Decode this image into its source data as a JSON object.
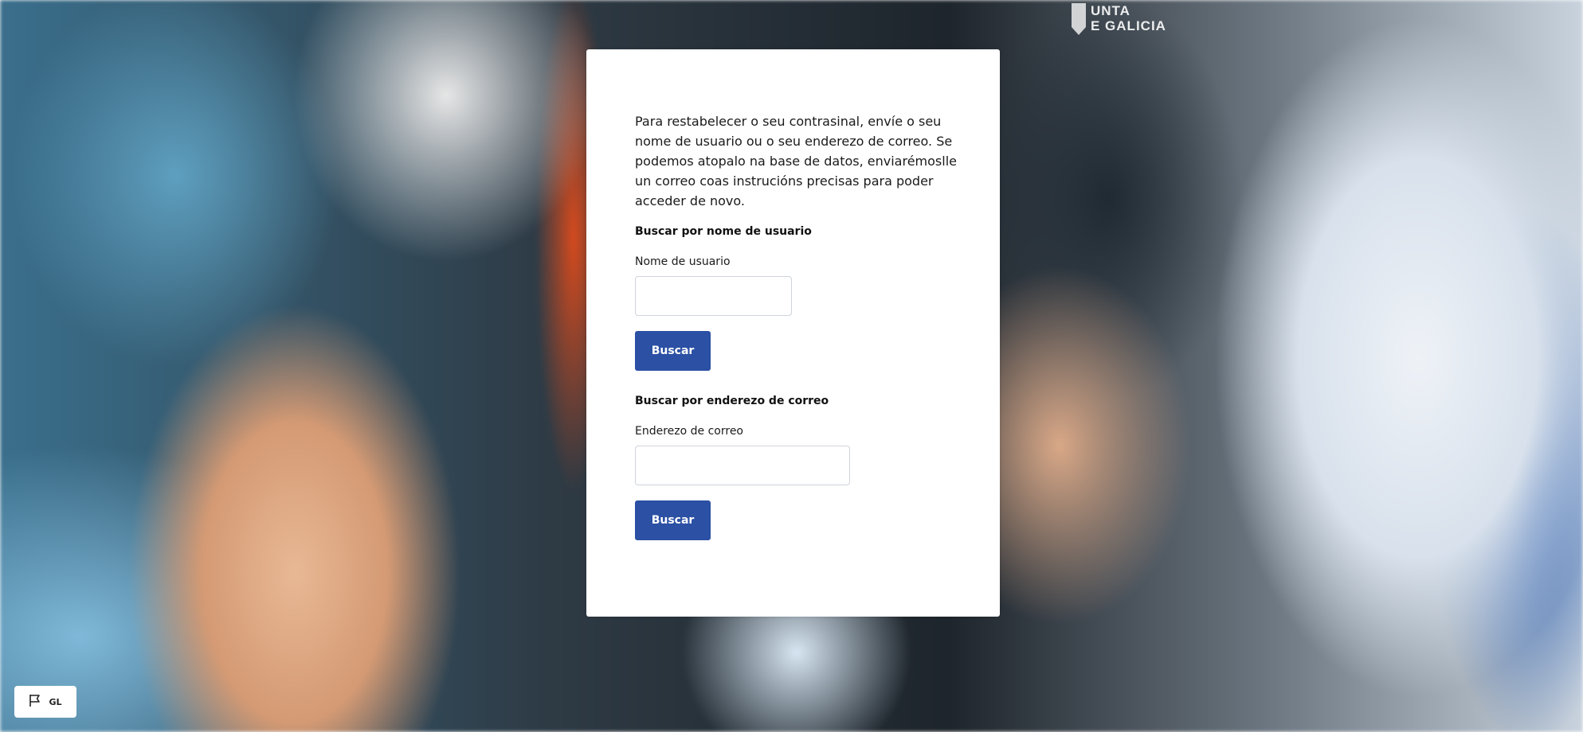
{
  "logo": {
    "text_line1": "UNTA",
    "text_line2": "E GALICIA"
  },
  "form": {
    "intro": "Para restabelecer o seu contrasinal, envíe o seu nome de usuario ou o seu enderezo de correo. Se podemos atopalo na base de datos, enviarémoslle un correo coas instrucións precisas para poder acceder de novo.",
    "username_section": {
      "title": "Buscar por nome de usuario",
      "label": "Nome de usuario",
      "value": "",
      "button_label": "Buscar"
    },
    "email_section": {
      "title": "Buscar por enderezo de correo",
      "label": "Enderezo de correo",
      "value": "",
      "button_label": "Buscar"
    }
  },
  "language_selector": {
    "icon": "flag-icon",
    "code": "GL"
  },
  "colors": {
    "button": "#2b50a4",
    "card": "#ffffff"
  }
}
